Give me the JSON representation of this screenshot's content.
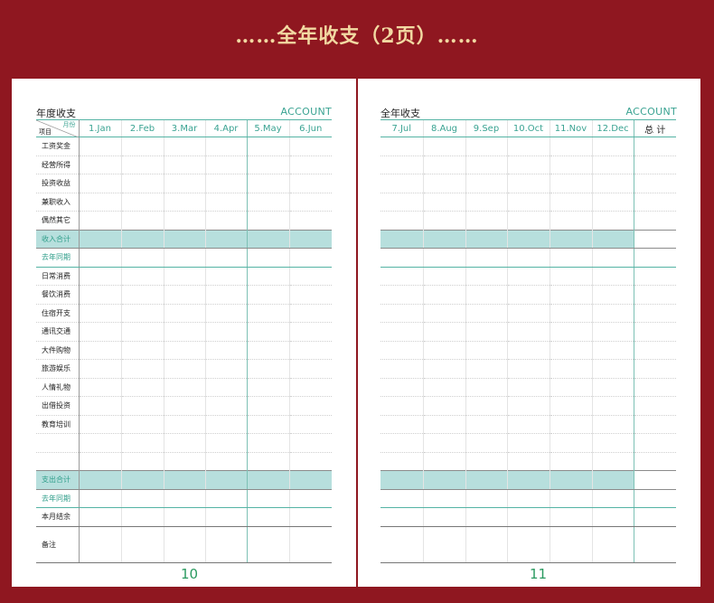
{
  "banner": "……全年收支（2页）……",
  "left": {
    "title": "年度收支",
    "account": "ACCOUNT",
    "corner_month": "月份",
    "corner_item": "项目",
    "months": [
      "1.Jan",
      "2.Feb",
      "3.Mar",
      "4.Apr",
      "5.May",
      "6.Jun"
    ],
    "page_number": "10"
  },
  "right": {
    "title": "全年收支",
    "account": "ACCOUNT",
    "months": [
      "7.Jul",
      "8.Aug",
      "9.Sep",
      "10.Oct",
      "11.Nov",
      "12.Dec"
    ],
    "total": "总 计",
    "page_number": "11"
  },
  "rows": [
    "工资奖金",
    "经营所得",
    "投资收益",
    "兼职收入",
    "偶然其它",
    "收入合计",
    "去年同期",
    "日常消费",
    "餐饮消费",
    "住宿开支",
    "通讯交通",
    "大件购物",
    "旅游娱乐",
    "人情礼物",
    "出借投资",
    "教育培训",
    "",
    "",
    "支出合计",
    "去年同期",
    "本月结余",
    "备注"
  ],
  "colors": {
    "background": "#8f1720",
    "accent": "#3aa392",
    "shade": "#b7dfdd",
    "banner": "#f2d9a2"
  }
}
